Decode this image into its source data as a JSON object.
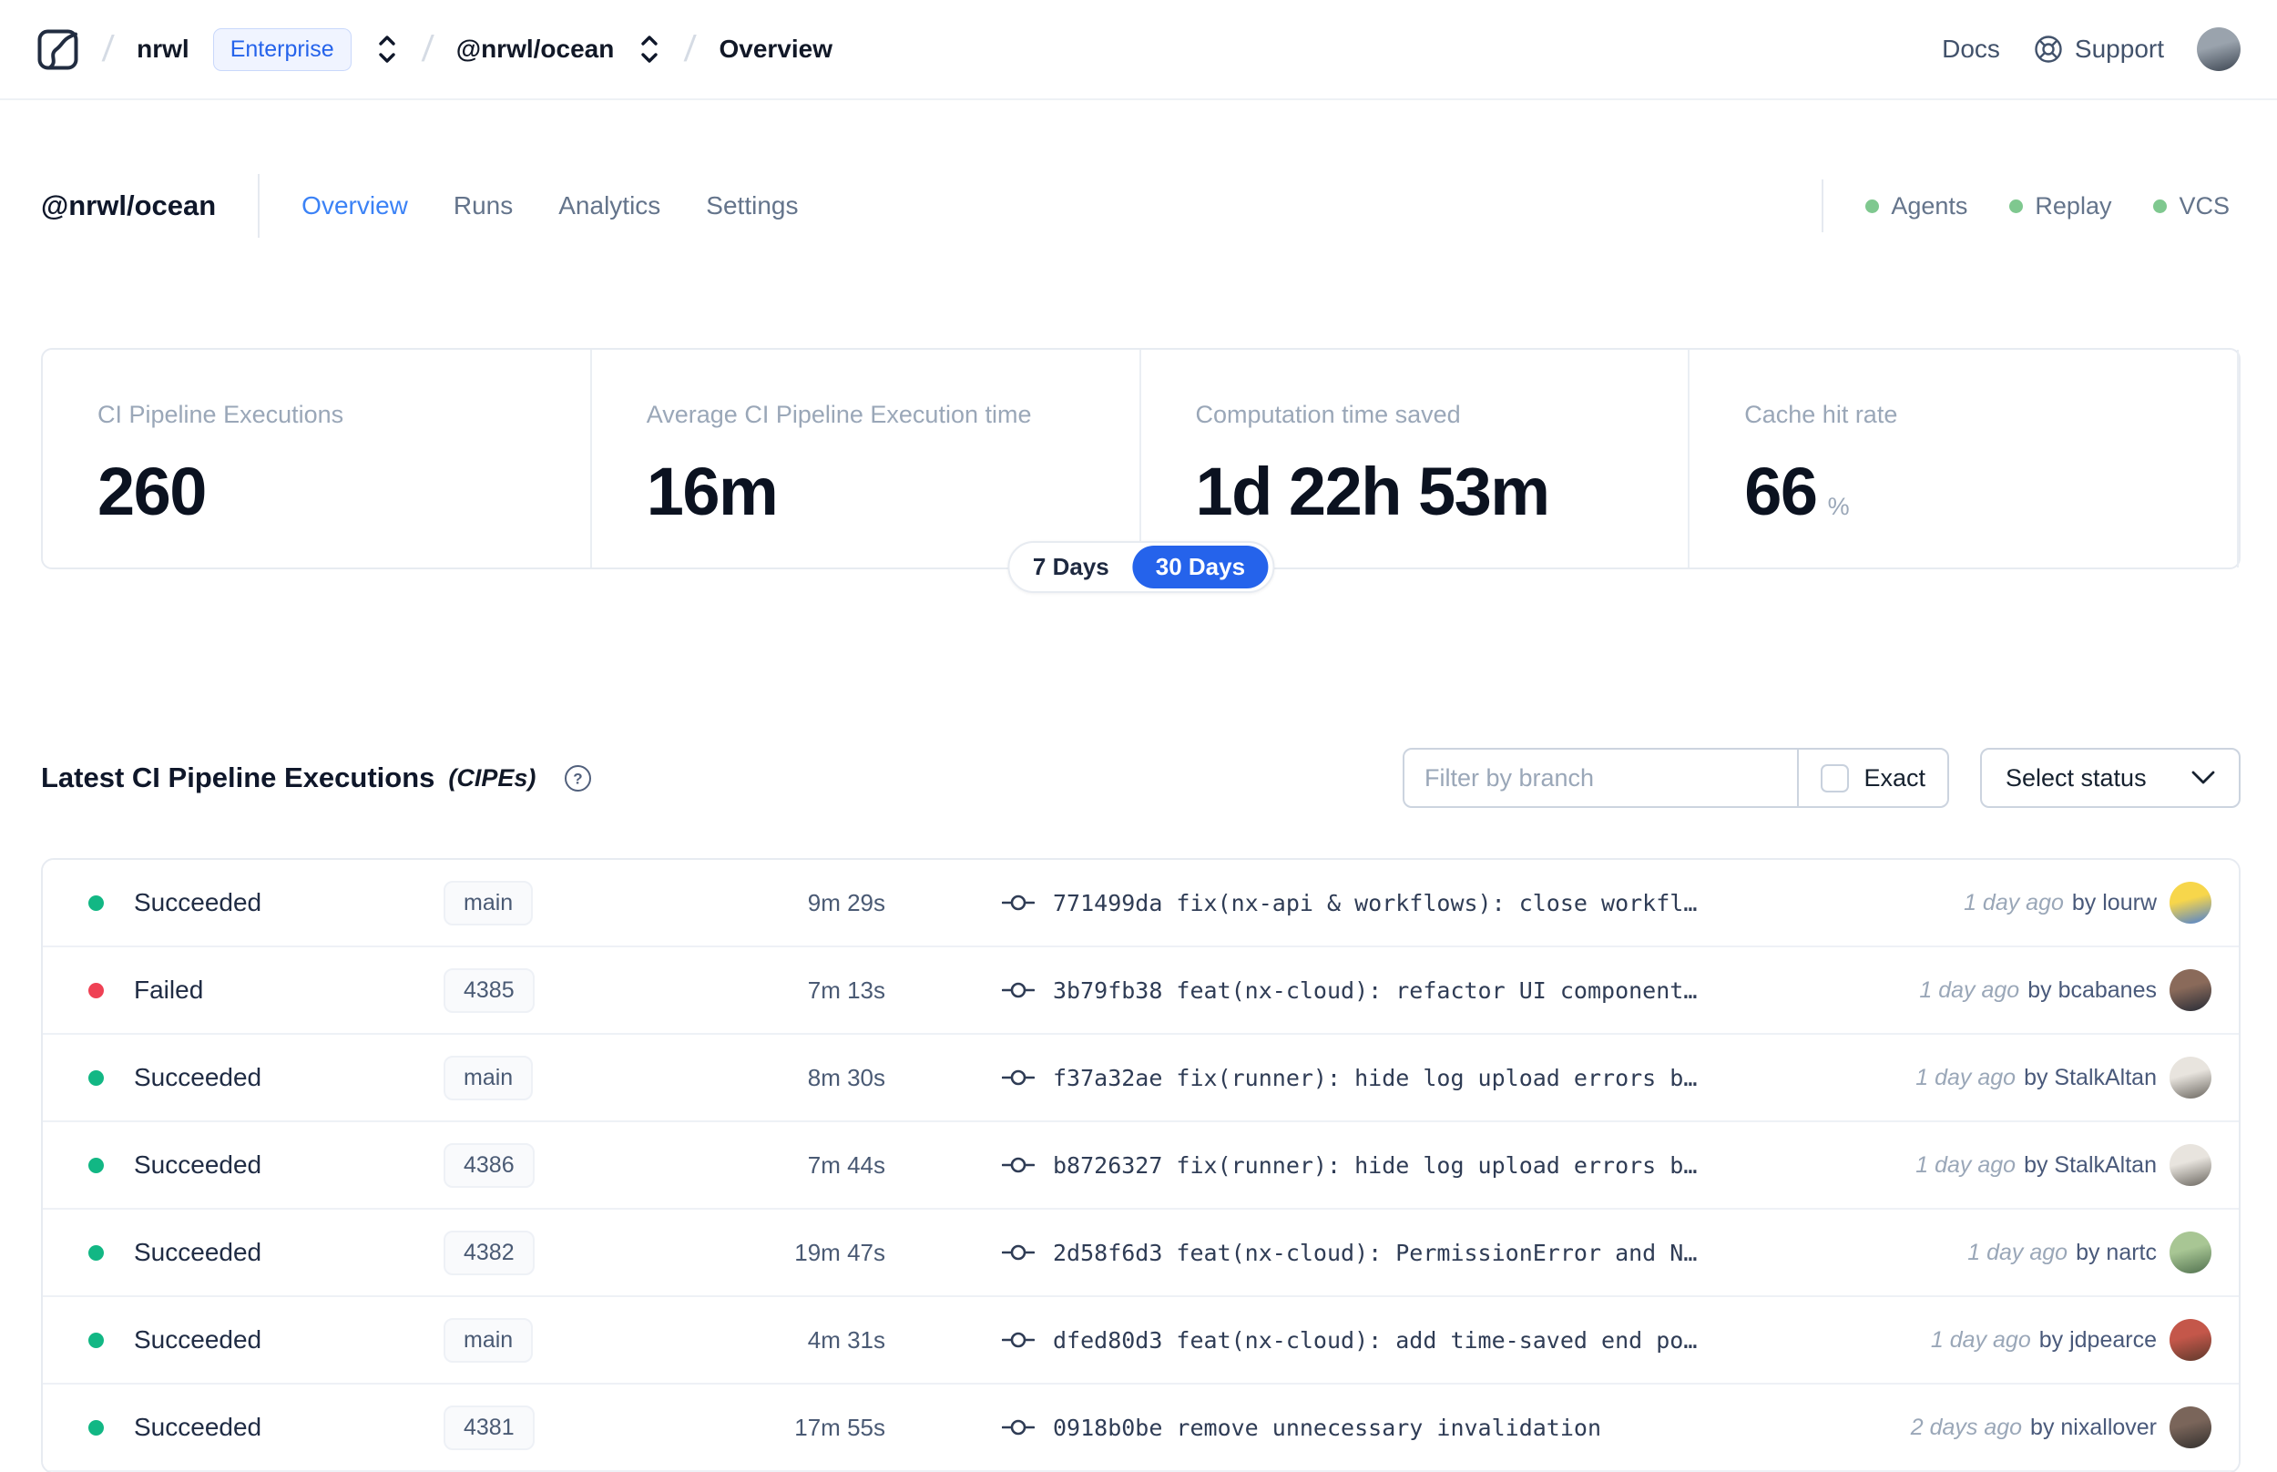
{
  "navbar": {
    "breadcrumb": {
      "org": "nrwl",
      "org_badge": "Enterprise",
      "workspace": "@nrwl/ocean",
      "page": "Overview"
    },
    "links": {
      "docs": "Docs",
      "support": "Support"
    },
    "avatar_colors": [
      "#9aa3ad",
      "#3d4652"
    ]
  },
  "header": {
    "title": "@nrwl/ocean",
    "tabs": [
      {
        "label": "Overview",
        "active": true
      },
      {
        "label": "Runs",
        "active": false
      },
      {
        "label": "Analytics",
        "active": false
      },
      {
        "label": "Settings",
        "active": false
      }
    ],
    "statuses": [
      {
        "label": "Agents",
        "color": "#7fc88f"
      },
      {
        "label": "Replay",
        "color": "#7fc88f"
      },
      {
        "label": "VCS",
        "color": "#7fc88f"
      }
    ]
  },
  "stats": {
    "cards": [
      {
        "label": "CI Pipeline Executions",
        "value": "260",
        "suffix": ""
      },
      {
        "label": "Average CI Pipeline Execution time",
        "value": "16m",
        "suffix": ""
      },
      {
        "label": "Computation time saved",
        "value": "1d 22h 53m",
        "suffix": ""
      },
      {
        "label": "Cache hit rate",
        "value": "66",
        "suffix": "%"
      }
    ],
    "range_toggle": {
      "options": [
        "7 Days",
        "30 Days"
      ],
      "selected": "30 Days",
      "selected_color": "#2563eb"
    }
  },
  "cipes": {
    "title": "Latest CI Pipeline Executions",
    "title_suffix": "(CIPEs)",
    "filter": {
      "placeholder": "Filter by branch",
      "exact_label": "Exact",
      "exact_checked": false,
      "status_button": "Select status"
    },
    "rows": [
      {
        "status": "Succeeded",
        "status_color": "#12b784",
        "branch": "main",
        "duration": "9m 29s",
        "commit_hash": "771499da",
        "commit_message": "fix(nx-api & workflows): close workfl…",
        "time": "1 day ago",
        "author": "by lourw",
        "avatar_colors": [
          "#f7d64b",
          "#4a7fd4"
        ]
      },
      {
        "status": "Failed",
        "status_color": "#ef4154",
        "branch": "4385",
        "duration": "7m 13s",
        "commit_hash": "3b79fb38",
        "commit_message": "feat(nx-cloud): refactor UI component…",
        "time": "1 day ago",
        "author": "by bcabanes",
        "avatar_colors": [
          "#8a6a5a",
          "#262b36"
        ]
      },
      {
        "status": "Succeeded",
        "status_color": "#12b784",
        "branch": "main",
        "duration": "8m 30s",
        "commit_hash": "f37a32ae",
        "commit_message": "fix(runner): hide log upload errors b…",
        "time": "1 day ago",
        "author": "by StalkAltan",
        "avatar_colors": [
          "#e8e4de",
          "#6a665f"
        ]
      },
      {
        "status": "Succeeded",
        "status_color": "#12b784",
        "branch": "4386",
        "duration": "7m 44s",
        "commit_hash": "b8726327",
        "commit_message": "fix(runner): hide log upload errors b…",
        "time": "1 day ago",
        "author": "by StalkAltan",
        "avatar_colors": [
          "#e8e4de",
          "#6a665f"
        ]
      },
      {
        "status": "Succeeded",
        "status_color": "#12b784",
        "branch": "4382",
        "duration": "19m 47s",
        "commit_hash": "2d58f6d3",
        "commit_message": "feat(nx-cloud): PermissionError and N…",
        "time": "1 day ago",
        "author": "by nartc",
        "avatar_colors": [
          "#a8c694",
          "#51714f"
        ]
      },
      {
        "status": "Succeeded",
        "status_color": "#12b784",
        "branch": "main",
        "duration": "4m 31s",
        "commit_hash": "dfed80d3",
        "commit_message": "feat(nx-cloud): add time-saved end po…",
        "time": "1 day ago",
        "author": "by jdpearce",
        "avatar_colors": [
          "#c4574a",
          "#5e392c"
        ]
      },
      {
        "status": "Succeeded",
        "status_color": "#12b784",
        "branch": "4381",
        "duration": "17m 55s",
        "commit_hash": "0918b0be",
        "commit_message": "remove unnecessary invalidation",
        "time": "2 days ago",
        "author": "by nixallover",
        "avatar_colors": [
          "#7a655a",
          "#33302e"
        ]
      }
    ]
  }
}
